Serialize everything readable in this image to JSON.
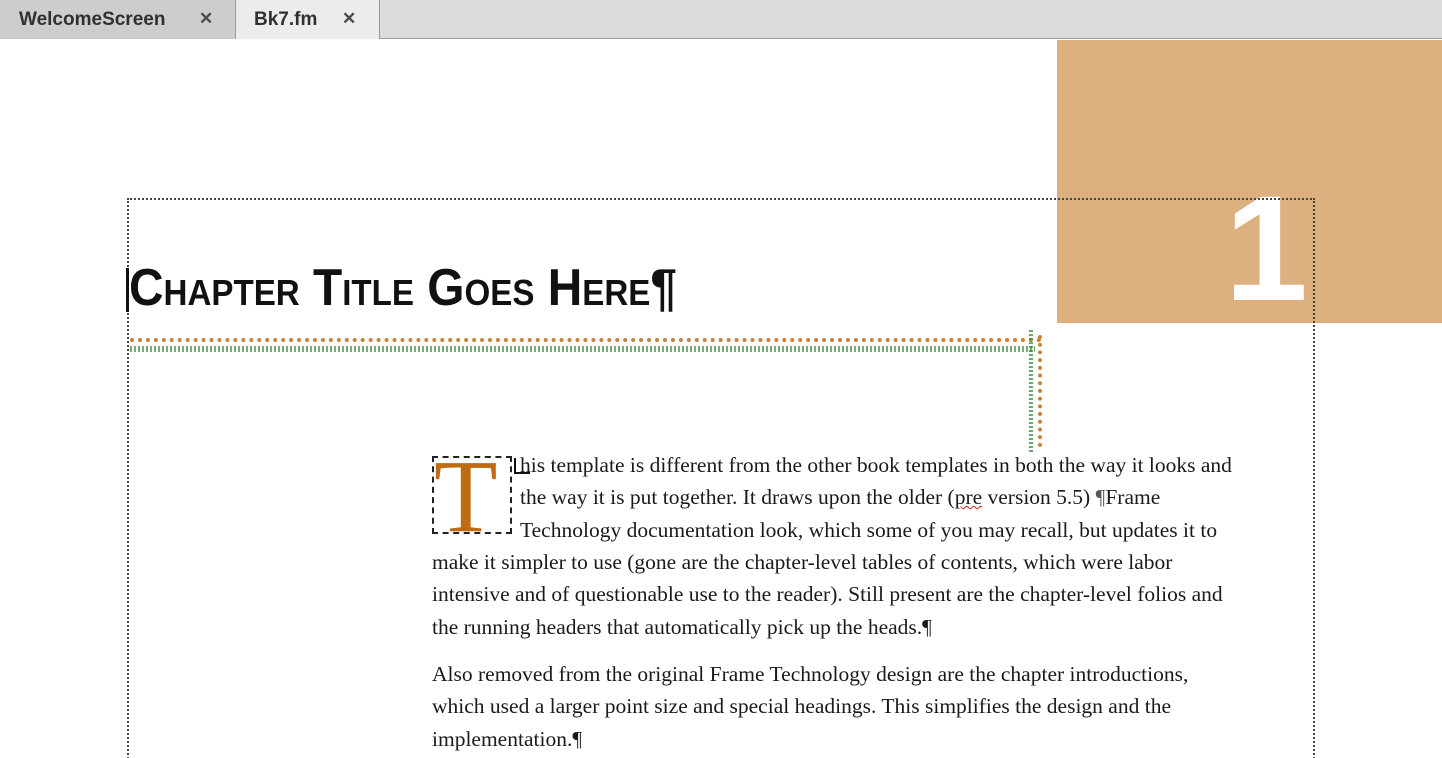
{
  "tabs": [
    {
      "label": "WelcomeScreen",
      "close": "✕"
    },
    {
      "label": "Bk7.fm",
      "close": "✕"
    }
  ],
  "document": {
    "chapter_number": "1",
    "chapter_title": "Chapter Title Goes Here¶",
    "drop_cap": "T",
    "para1_lines": [
      "his template is different from the other book templates in both the way it looks and",
      "the way it is put together. It draws upon the older (",
      "pre",
      " version 5.5) ",
      "¶",
      "Frame",
      "Technology documentation look, which some of you may recall, but updates it to",
      "make it simpler to use (gone are the chapter-level tables of contents, which were labor",
      "intensive and of questionable use to the reader). Still present are the chapter-level folios and",
      "the running headers that automatically pick up the heads.¶"
    ],
    "para2_lines": [
      "Also removed from the original Frame Technology design are the chapter introductions,",
      "which used a larger point size and special headings. This simplifies the design and the",
      "implementation.¶"
    ]
  },
  "colors": {
    "accent_block": "#dcb07f",
    "drop_cap": "#c06a12"
  }
}
